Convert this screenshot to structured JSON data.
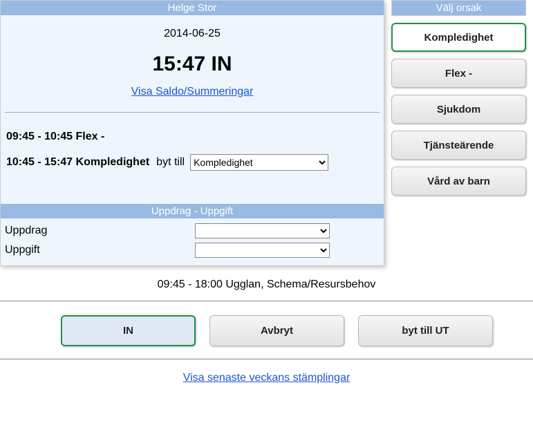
{
  "left": {
    "title": "Helge Stor",
    "date": "2014-06-25",
    "time_status": "15:47 IN",
    "summary_link": "Visa Saldo/Summeringar",
    "entries": [
      {
        "text": "09:45 - 10:45 Flex -",
        "switchable": false
      },
      {
        "text": "10:45 - 15:47 Kompledighet",
        "switchable": true,
        "switch_label": "byt till",
        "select_value": "Kompledighet"
      }
    ],
    "sub_title": "Uppdrag - Uppgift",
    "form": {
      "uppdrag_label": "Uppdrag",
      "uppgift_label": "Uppgift"
    }
  },
  "right": {
    "title": "Välj orsak",
    "reasons": [
      {
        "label": "Kompledighet",
        "selected": true
      },
      {
        "label": "Flex -",
        "selected": false
      },
      {
        "label": "Sjukdom",
        "selected": false
      },
      {
        "label": "Tjänsteärende",
        "selected": false
      },
      {
        "label": "Vård av barn",
        "selected": false
      }
    ]
  },
  "schedule_line": "09:45 - 18:00 Ugglan, Schema/Resursbehov",
  "actions": {
    "in": "IN",
    "cancel": "Avbryt",
    "switch_out": "byt till UT"
  },
  "bottom_link": "Visa senaste veckans stämplingar"
}
